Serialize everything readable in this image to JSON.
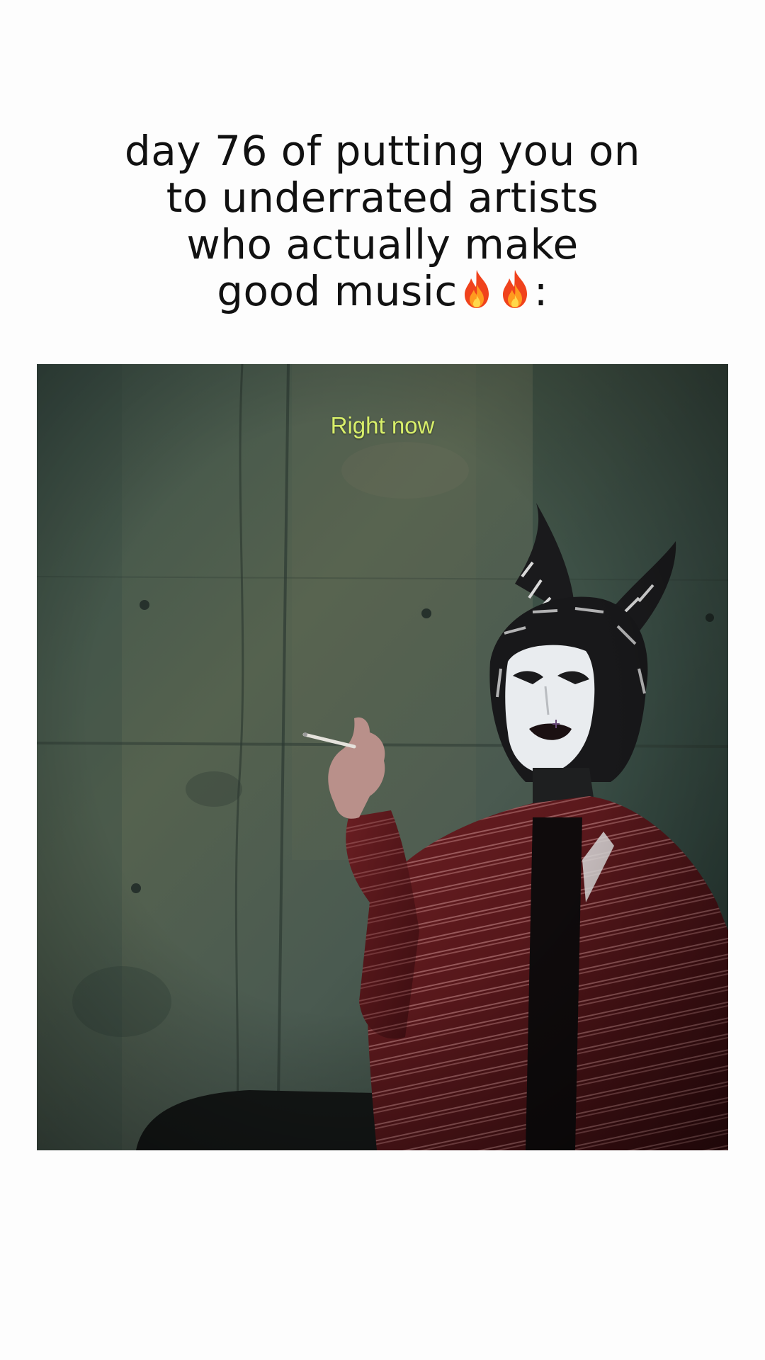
{
  "caption": {
    "line1": "day 76 of putting you on",
    "line2": "to underrated artists",
    "line3": "who actually make",
    "line4_text": "good music",
    "line4_suffix": ":",
    "flame_icon": "fire-emoji",
    "flame_count": 2
  },
  "video": {
    "overlay_text": "Right now",
    "overlay_color": "#d8ef6a"
  },
  "colors": {
    "background": "#fdfdfd",
    "text": "#111111",
    "wall": "#4a5b52",
    "jacket": "#5a1a1e"
  }
}
